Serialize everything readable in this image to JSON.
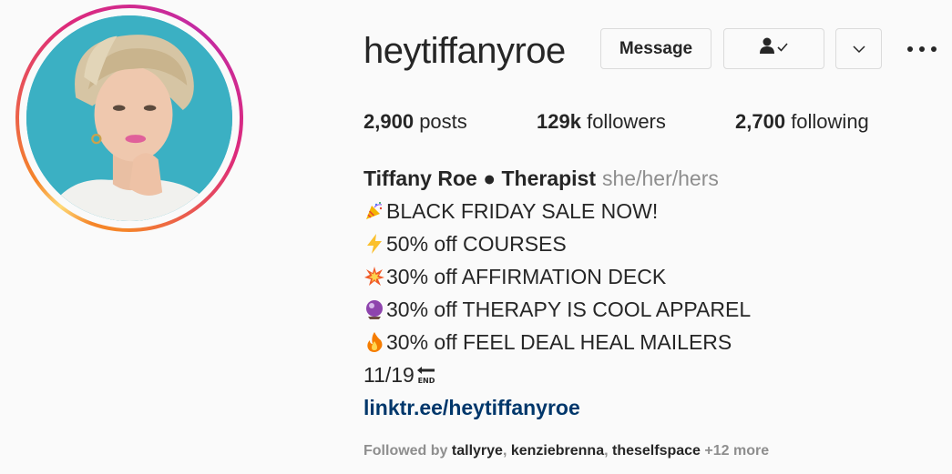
{
  "profile": {
    "username": "heytiffanyroe",
    "message_label": "Message",
    "icons": {
      "follow": "person-check-icon",
      "chevron": "chevron-down-icon",
      "more": "more-options-icon"
    }
  },
  "stats": {
    "posts_count": "2,900",
    "posts_label": "posts",
    "followers_count": "129k",
    "followers_label": "followers",
    "following_count": "2,700",
    "following_label": "following"
  },
  "bio": {
    "full_name": "Tiffany Roe ● Therapist",
    "pronouns": "she/her/hers",
    "lines": [
      {
        "emoji": "party-popper-icon",
        "text": "BLACK FRIDAY SALE NOW!"
      },
      {
        "emoji": "lightning-icon",
        "text": "50% off COURSES"
      },
      {
        "emoji": "collision-icon",
        "text": "30% off AFFIRMATION DECK"
      },
      {
        "emoji": "crystal-ball-icon",
        "text": "30% off THERAPY IS COOL APPAREL"
      },
      {
        "emoji": "fire-icon",
        "text": "30% off FEEL DEAL HEAL MAILERS"
      }
    ],
    "end_line": {
      "text": "11/19",
      "emoji": "end-arrow-icon"
    },
    "link": "linktr.ee/heytiffanyroe"
  },
  "followed_by": {
    "prefix": "Followed by",
    "names": [
      "tallyrye",
      "kenziebrenna",
      "theselfspace"
    ],
    "more": "+12 more"
  },
  "colors": {
    "link": "#00376b",
    "secondary_text": "#8e8e8e",
    "avatar_bg": "#3bb0c3"
  }
}
